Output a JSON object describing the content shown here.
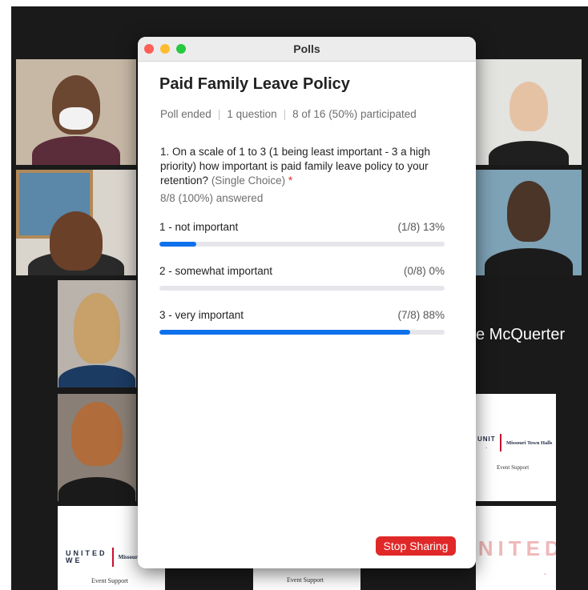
{
  "window": {
    "title": "Polls"
  },
  "poll": {
    "title": "Paid Family Leave Policy",
    "status": "Poll ended",
    "question_count": "1 question",
    "participation": "8 of 16 (50%) participated",
    "question_text": "1. On a scale of 1 to 3 (1 being least important - 3 a high priority) how important is paid family leave policy to your retention?",
    "question_type": "(Single Choice)",
    "required_marker": "*",
    "answered": "8/8 (100%) answered",
    "options": [
      {
        "label": "1 - not important",
        "result": "(1/8) 13%",
        "fraction": 0.13
      },
      {
        "label": "2 - somewhat important",
        "result": "(0/8) 0%",
        "fraction": 0
      },
      {
        "label": "3 - very important",
        "result": "(7/8) 88%",
        "fraction": 0.88
      }
    ]
  },
  "controls": {
    "stop_sharing_label": "Stop Sharing"
  },
  "gallery": {
    "participant_name": "e McQuerter",
    "logo_united": "UNITED",
    "logo_we": "WE",
    "logo_dot": ".",
    "logo_org": "Missouri Town Halls",
    "logo_org_partial": "Missouri T",
    "event_support": "Event Support"
  },
  "colors": {
    "accent": "#0e71eb",
    "stop_button": "#e02828",
    "track": "#e6e6ea"
  }
}
